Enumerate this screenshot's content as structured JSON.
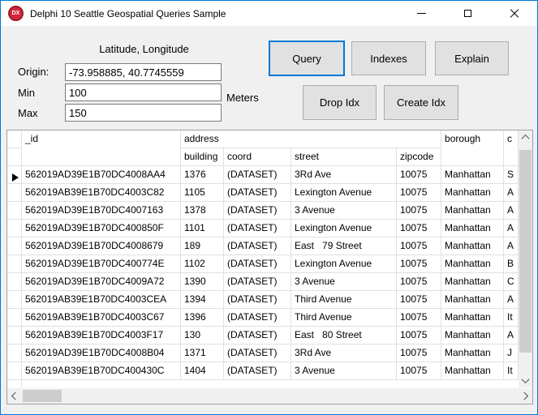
{
  "window": {
    "title": "Delphi 10 Seattle Geospatial Queries Sample",
    "icon_text": "DX"
  },
  "colors": {
    "accent_blue": "#0078d7",
    "app_icon_red": "#d3273a"
  },
  "form": {
    "coords_caption": "Latitude, Longitude",
    "origin_label": "Origin:",
    "origin_value": "-73.958885, 40.7745559",
    "min_label": "Min",
    "min_value": "100",
    "max_label": "Max",
    "max_value": "150",
    "meters_label": "Meters"
  },
  "buttons": {
    "query": "Query",
    "indexes": "Indexes",
    "explain": "Explain",
    "drop_idx": "Drop Idx",
    "create_idx": "Create Idx"
  },
  "grid": {
    "header": {
      "id": "_id",
      "address_group": "address",
      "building": "building",
      "coord": "coord",
      "street": "street",
      "zipcode": "zipcode",
      "borough": "borough",
      "cuisine_clipped": "c"
    },
    "rows": [
      {
        "current": true,
        "id": "562019AD39E1B70DC4008AA4",
        "building": "1376",
        "coord": "(DATASET)",
        "street": "3Rd Ave",
        "zipcode": "10075",
        "borough": "Manhattan",
        "cuisine": "S"
      },
      {
        "current": false,
        "id": "562019AB39E1B70DC4003C82",
        "building": "1105",
        "coord": "(DATASET)",
        "street": "Lexington Avenue",
        "zipcode": "10075",
        "borough": "Manhattan",
        "cuisine": "A"
      },
      {
        "current": false,
        "id": "562019AD39E1B70DC4007163",
        "building": "1378",
        "coord": "(DATASET)",
        "street": "3 Avenue",
        "zipcode": "10075",
        "borough": "Manhattan",
        "cuisine": "A"
      },
      {
        "current": false,
        "id": "562019AD39E1B70DC400850F",
        "building": "1101",
        "coord": "(DATASET)",
        "street": "Lexington Avenue",
        "zipcode": "10075",
        "borough": "Manhattan",
        "cuisine": "A"
      },
      {
        "current": false,
        "id": "562019AD39E1B70DC4008679",
        "building": "189",
        "coord": "(DATASET)",
        "street": "East   79 Street",
        "zipcode": "10075",
        "borough": "Manhattan",
        "cuisine": "A"
      },
      {
        "current": false,
        "id": "562019AD39E1B70DC400774E",
        "building": "1102",
        "coord": "(DATASET)",
        "street": "Lexington Avenue",
        "zipcode": "10075",
        "borough": "Manhattan",
        "cuisine": "B"
      },
      {
        "current": false,
        "id": "562019AD39E1B70DC4009A72",
        "building": "1390",
        "coord": "(DATASET)",
        "street": "3 Avenue",
        "zipcode": "10075",
        "borough": "Manhattan",
        "cuisine": "C"
      },
      {
        "current": false,
        "id": "562019AB39E1B70DC4003CEA",
        "building": "1394",
        "coord": "(DATASET)",
        "street": "Third Avenue",
        "zipcode": "10075",
        "borough": "Manhattan",
        "cuisine": "A"
      },
      {
        "current": false,
        "id": "562019AB39E1B70DC4003C67",
        "building": "1396",
        "coord": "(DATASET)",
        "street": "Third Avenue",
        "zipcode": "10075",
        "borough": "Manhattan",
        "cuisine": "It"
      },
      {
        "current": false,
        "id": "562019AB39E1B70DC4003F17",
        "building": "130",
        "coord": "(DATASET)",
        "street": "East   80 Street",
        "zipcode": "10075",
        "borough": "Manhattan",
        "cuisine": "A"
      },
      {
        "current": false,
        "id": "562019AD39E1B70DC4008B04",
        "building": "1371",
        "coord": "(DATASET)",
        "street": "3Rd Ave",
        "zipcode": "10075",
        "borough": "Manhattan",
        "cuisine": "J"
      },
      {
        "current": false,
        "id": "562019AB39E1B70DC400430C",
        "building": "1404",
        "coord": "(DATASET)",
        "street": "3 Avenue",
        "zipcode": "10075",
        "borough": "Manhattan",
        "cuisine": "It"
      }
    ]
  }
}
